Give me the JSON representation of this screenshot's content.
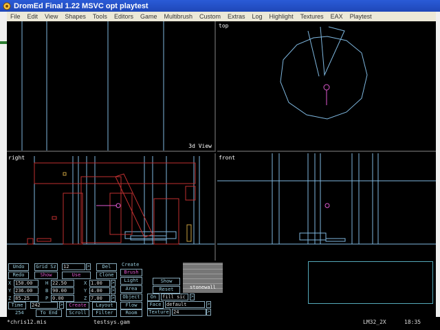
{
  "title": "DromEd Final 1.22 MSVC opt playtest",
  "menu": [
    "File",
    "Edit",
    "View",
    "Shapes",
    "Tools",
    "Editors",
    "Game",
    "Multibrush",
    "Custom",
    "Extras",
    "Log",
    "Highlight",
    "Textures",
    "EAX",
    "Playtest"
  ],
  "views": {
    "top_left_label": "3d View",
    "top_right_label": "top",
    "bottom_left_label": "right",
    "bottom_right_label": "front"
  },
  "panel": {
    "undo": "Undo",
    "redo": "Redo",
    "grid_sz_label": "Grid Sz",
    "grid_sz": "12",
    "show": "Show",
    "use": "Use",
    "del": "Del",
    "clone": "Clone",
    "create": "Create",
    "brush": "Brush",
    "light": "Light",
    "area": "Area",
    "object": "Object",
    "flow": "Flow",
    "room": "Room",
    "show2": "Show",
    "reset": "Reset",
    "on": "On",
    "fill_sic": "fill sic",
    "face": "Face",
    "face_val": "default",
    "texture": "Texture",
    "texture_val": "24",
    "texture_name": "stonewall",
    "row_x": {
      "label": "X",
      "pos": "150.00",
      "h": "H",
      "rot": "22.50",
      "x": "X",
      "size": "1.00"
    },
    "row_y": {
      "label": "Y",
      "pos": "236.00",
      "b": "B",
      "rot": "90.00",
      "y": "Y",
      "size": "4.00"
    },
    "row_z": {
      "label": "Z",
      "pos": "85.25",
      "p": "P",
      "rot": "0.00",
      "z": "Z",
      "size": "7.00"
    },
    "time_label": "Time",
    "time_val": "242",
    "count": "254",
    "create2": "Create",
    "layout": "Layout",
    "to_end": "To End",
    "scroll": "Scroll",
    "filter": "Filter",
    "arrow_right": ">",
    "arrow_left": "<"
  },
  "status": {
    "file": "*chris12.mis",
    "gam": "testsys.gam",
    "lm": "LM32_2X",
    "time": "18:35"
  },
  "colors": {
    "wire_blue": "#7fb8e0",
    "wire_red": "#c03030",
    "magenta": "#e05ad0"
  }
}
